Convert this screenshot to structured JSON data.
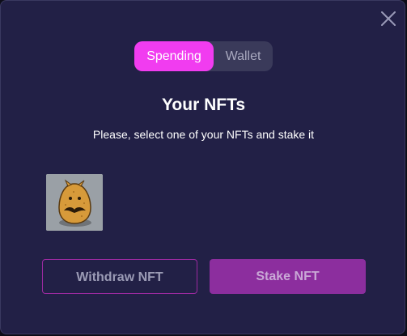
{
  "modal": {
    "close_icon": "close-icon",
    "toggle": {
      "options": [
        {
          "label": "Spending",
          "active": true
        },
        {
          "label": "Wallet",
          "active": false
        }
      ]
    },
    "title": "Your NFTs",
    "subtitle": "Please, select one of your NFTs and stake it",
    "nfts": [
      {
        "icon": "nft-creature-thumbnail"
      }
    ],
    "buttons": {
      "withdraw_label": "Withdraw NFT",
      "stake_label": "Stake NFT"
    }
  },
  "colors": {
    "background": "#222046",
    "accent": "#f13cf0",
    "toggle_bg": "#3a3a5a",
    "stake_button": "#8c2e9e",
    "withdraw_border": "#9b2aa0"
  }
}
